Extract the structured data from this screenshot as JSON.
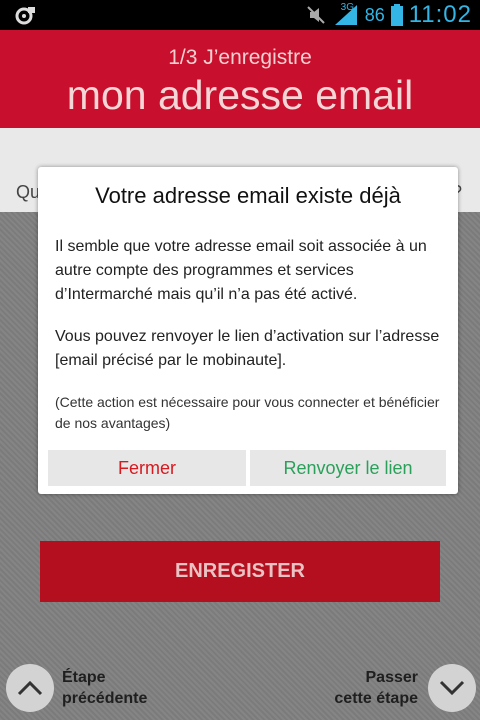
{
  "status_bar": {
    "network": "3G",
    "battery": "86",
    "time": "11:02"
  },
  "header": {
    "step": "1/3 J’enregistre",
    "title": "mon adresse email"
  },
  "band": {
    "question_start": "Qu",
    "question_end": "?"
  },
  "dialog": {
    "title": "Votre adresse email existe déjà",
    "paragraph1": "Il semble que votre adresse email soit associée à un autre compte des programmes et services d’Intermarché mais qu’il n’a pas été activé.",
    "paragraph2": "Vous pouvez renvoyer le lien d’activation sur l’adresse [email précisé par le mobinaute].",
    "note": "(Cette action est nécessaire pour vous connecter et bénéficier de nos avantages)",
    "close_label": "Fermer",
    "resend_label": "Renvoyer le lien"
  },
  "form": {
    "register_label": "ENREGISTER"
  },
  "nav": {
    "prev_line1": "Étape",
    "prev_line2": "précédente",
    "next_line1": "Passer",
    "next_line2": "cette étape"
  },
  "colors": {
    "brand_red": "#c8102e",
    "close_text": "#d71920",
    "resend_text": "#2aa05a",
    "status_accent": "#33b5e5"
  }
}
